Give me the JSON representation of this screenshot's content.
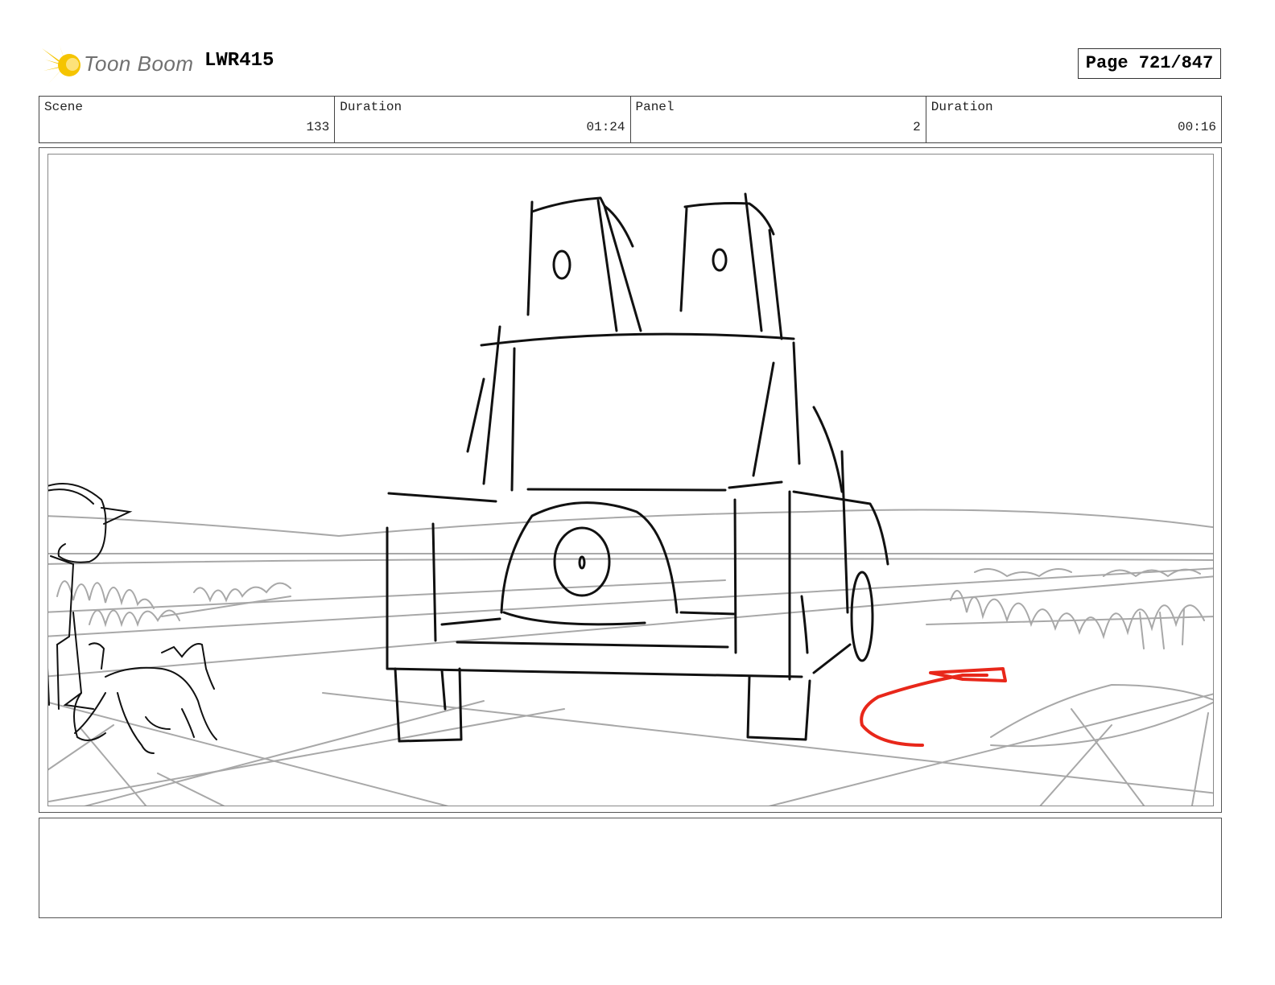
{
  "header": {
    "brand": "Toon Boom",
    "production_code": "LWR415",
    "page_label": "Page 721/847"
  },
  "info": {
    "scene": {
      "label": "Scene",
      "value": "133"
    },
    "scene_duration": {
      "label": "Duration",
      "value": "01:24"
    },
    "panel": {
      "label": "Panel",
      "value": "2"
    },
    "panel_duration": {
      "label": "Duration",
      "value": "00:16"
    }
  },
  "colors": {
    "sketch_ink": "#111111",
    "background_pencil": "#a8a8a8",
    "direction_arrow": "#e8271a",
    "logo_yellow": "#f5c400"
  },
  "notes": ""
}
